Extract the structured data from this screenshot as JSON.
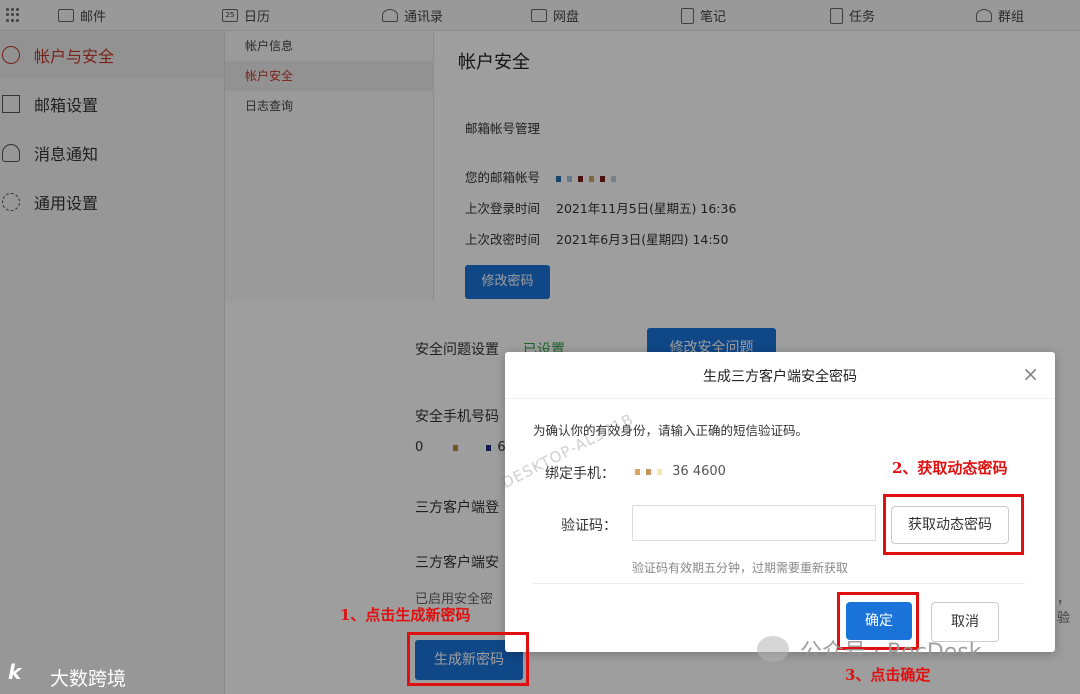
{
  "topnav": [
    {
      "icon": "mail-icon",
      "label": "邮件"
    },
    {
      "icon": "calendar-icon",
      "label": "日历"
    },
    {
      "icon": "contacts-icon",
      "label": "通讯录"
    },
    {
      "icon": "drive-icon",
      "label": "网盘"
    },
    {
      "icon": "notes-icon",
      "label": "笔记"
    },
    {
      "icon": "tasks-icon",
      "label": "任务"
    },
    {
      "icon": "group-icon",
      "label": "群组"
    }
  ],
  "calendar_day": "25",
  "sidebar": {
    "items": [
      {
        "label": "帐户与安全",
        "icon": "user-circle-icon",
        "active": true
      },
      {
        "label": "邮箱设置",
        "icon": "mail-settings-icon"
      },
      {
        "label": "消息通知",
        "icon": "bell-icon"
      },
      {
        "label": "通用设置",
        "icon": "gear-icon"
      }
    ]
  },
  "subnav": {
    "items": [
      {
        "label": "帐户信息"
      },
      {
        "label": "帐户安全",
        "active": true
      },
      {
        "label": "日志查询"
      }
    ]
  },
  "main": {
    "title": "帐户安全",
    "section_title": "邮箱帐号管理",
    "email_label": "您的邮箱帐号",
    "last_login_label": "上次登录时间",
    "last_login_value": "2021年11月5日(星期五) 16:36",
    "last_pwd_label": "上次改密时间",
    "last_pwd_value": "2021年6月3日(星期四) 14:50",
    "change_pwd_button": "修改密码",
    "security_question_label": "安全问题设置",
    "security_question_status": "已设置",
    "change_question_button": "修改安全问题",
    "security_phone_label": "安全手机号码",
    "phone_partial": "0",
    "phone_partial2": "6",
    "third_login_label": "三方客户端登",
    "third_pwd_label": "三方客户端安",
    "enabled_text": "已启用安全密",
    "right_edge_text": "，验",
    "generate_button": "生成新密码"
  },
  "modal": {
    "title": "生成三方客户端安全密码",
    "close": "×",
    "info": "为确认你的有效身份，请输入正确的短信验证码。",
    "phone_label": "绑定手机：",
    "phone_value": "36 4600",
    "code_label": "验证码：",
    "code_value": "",
    "get_code_button": "获取动态密码",
    "hint": "验证码有效期五分钟，过期需要重新获取",
    "confirm_button": "确定",
    "cancel_button": "取消",
    "watermark": "DESKTOP-AL371B"
  },
  "annotations": {
    "step1": "1、点击生成新密码",
    "step2": "2、获取动态密码",
    "step3": "3、点击确定"
  },
  "watermarks": {
    "wechat": "公众号 · RocDesk",
    "brand": "大数跨境",
    "brand_logo": "k"
  },
  "colors": {
    "accent": "#1a73d9",
    "active_red": "#c0392b",
    "annotation_red": "#e01010",
    "status_green": "#2e9e44"
  }
}
